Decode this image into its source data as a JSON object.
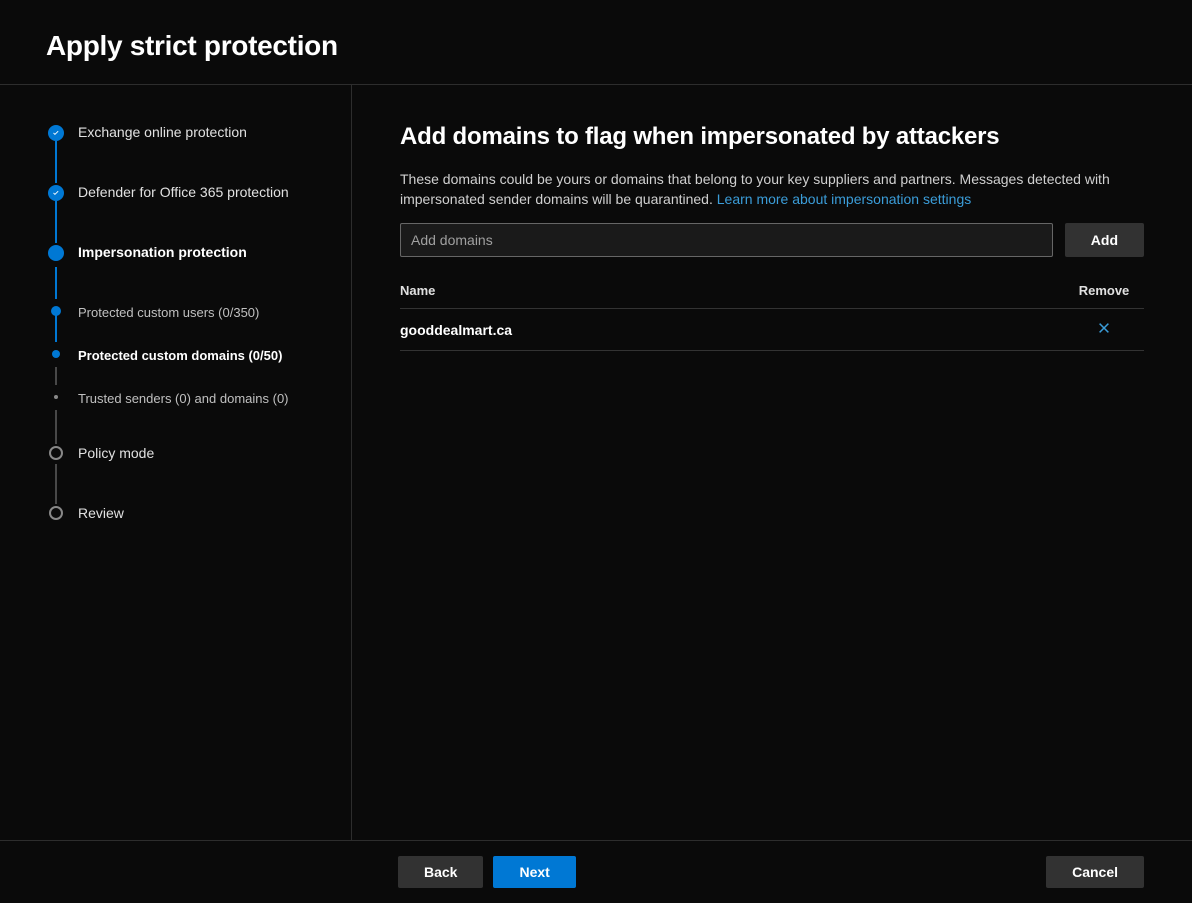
{
  "header": {
    "title": "Apply strict protection"
  },
  "sidebar": {
    "steps": [
      {
        "label": "Exchange online protection",
        "state": "done"
      },
      {
        "label": "Defender for Office 365 protection",
        "state": "done"
      },
      {
        "label": "Impersonation protection",
        "state": "current",
        "sub": [
          {
            "label": "Protected custom users (0/350)",
            "state": "done"
          },
          {
            "label": "Protected custom domains (0/50)",
            "state": "current"
          },
          {
            "label": "Trusted senders (0) and domains (0)",
            "state": "pending"
          }
        ]
      },
      {
        "label": "Policy mode",
        "state": "pending"
      },
      {
        "label": "Review",
        "state": "pending"
      }
    ]
  },
  "main": {
    "heading": "Add domains to flag when impersonated by attackers",
    "description": "These domains could be yours or domains that belong to your key suppliers and partners. Messages detected with impersonated sender domains will be quarantined. ",
    "link_text": "Learn more about impersonation settings",
    "input_placeholder": "Add domains",
    "add_button": "Add",
    "table": {
      "col_name": "Name",
      "col_remove": "Remove",
      "rows": [
        {
          "name": "gooddealmart.ca"
        }
      ]
    }
  },
  "footer": {
    "back": "Back",
    "next": "Next",
    "cancel": "Cancel"
  }
}
